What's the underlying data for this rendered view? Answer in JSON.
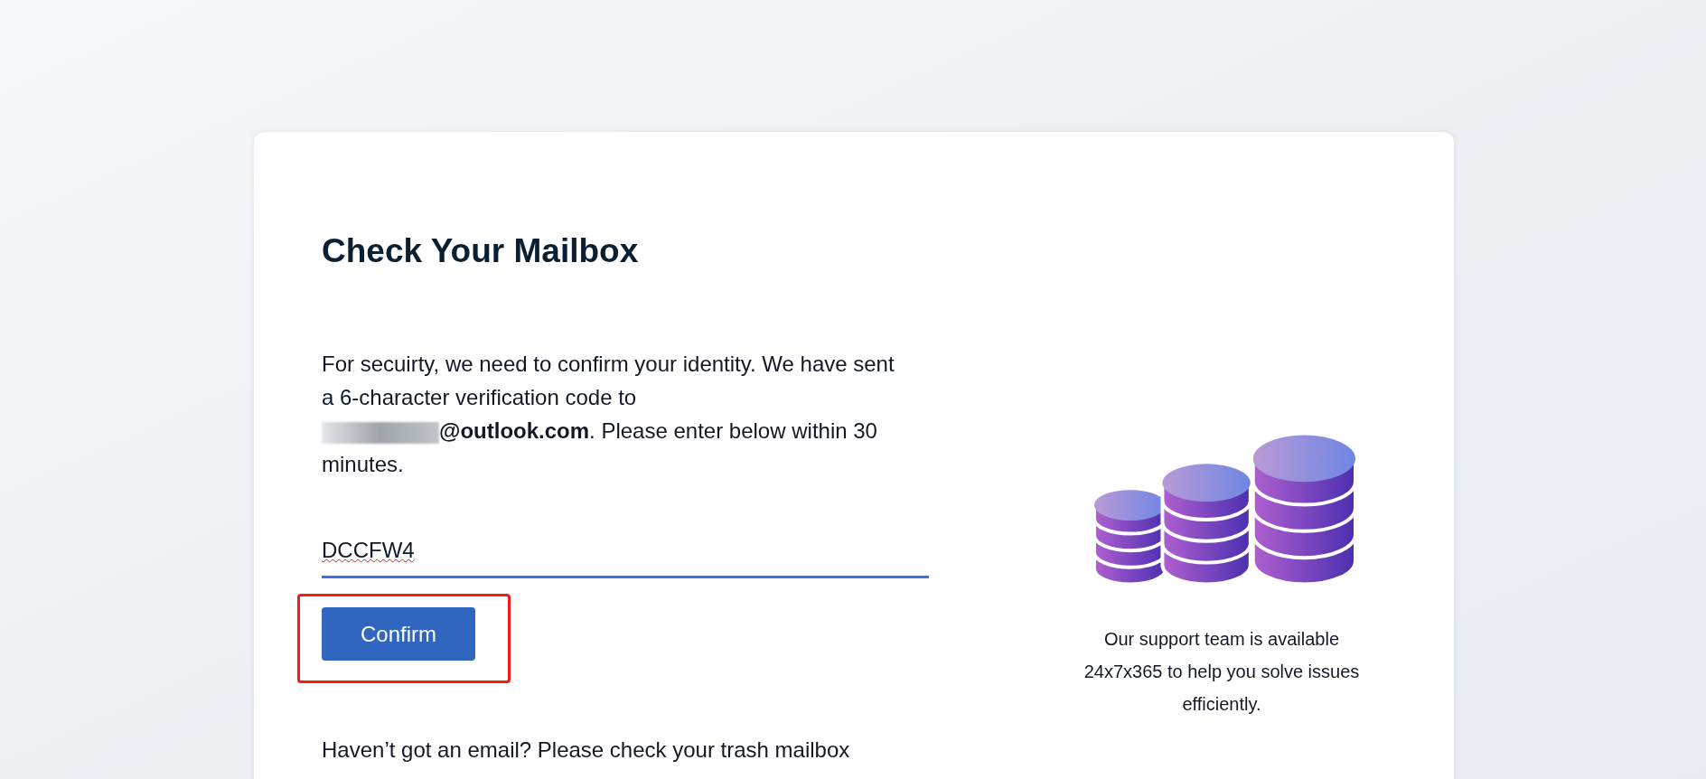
{
  "title": "Check Your Mailbox",
  "message": {
    "lead": "For secuirty, we need to confirm your identity. We have sent a 6-character verification code to",
    "redacted": true,
    "email": "@outlook.com",
    "tail": ". Please enter below within 30 minutes."
  },
  "code_field": {
    "value": "DCCFW4",
    "focused": true,
    "misspelled": true
  },
  "confirm_button": {
    "label": "Confirm",
    "highlighted": true
  },
  "footer_text": "Haven’t got an email? Please check your trash mailbox",
  "support": {
    "text": "Our support team is available 24x7x365 to help you solve issues efficiently."
  }
}
